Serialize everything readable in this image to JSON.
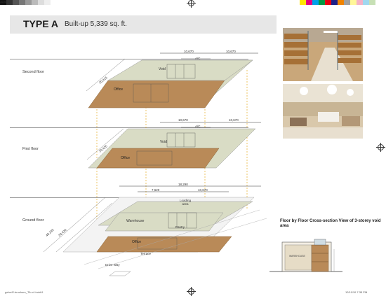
{
  "header": {
    "type_label": "TYPE A",
    "area_label": "Built-up 5,339 sq. ft."
  },
  "floors": {
    "second": "Second floor",
    "first": "First floor",
    "ground": "Ground floor"
  },
  "dimensions": {
    "second_left": "10,670",
    "second_right": "10,670",
    "second_side": "20,425",
    "first_left": "10,670",
    "first_right": "10,670",
    "first_side": "20,425",
    "ground_total": "18,290",
    "ground_left": "7,620",
    "ground_right": "10,670",
    "ground_side_outer": "40,235",
    "ground_side_inner": "20,420"
  },
  "room_labels": {
    "void_second": "Void",
    "office_second": "Office",
    "ac_second": "A/C",
    "void_first": "Void",
    "office_first": "Office",
    "ac_first": "A/C",
    "loading": "Loading area",
    "warehouse": "Warehouse",
    "pantry": "Pantry",
    "office_ground": "Office",
    "terrace": "Terrace",
    "driveway": "Drive Way"
  },
  "section": {
    "caption": "Floor by Floor Cross-section View of 3-storey void area",
    "room_label": "WAREHOUSE"
  },
  "footer": {
    "left": "gelvel2-brochure_TA-v4.indd   6",
    "right": "12/11/10   7:35 PM"
  },
  "colors": {
    "slab": "#d9dcc5",
    "office": "#b98a58",
    "title_band": "#e7e7e7"
  }
}
